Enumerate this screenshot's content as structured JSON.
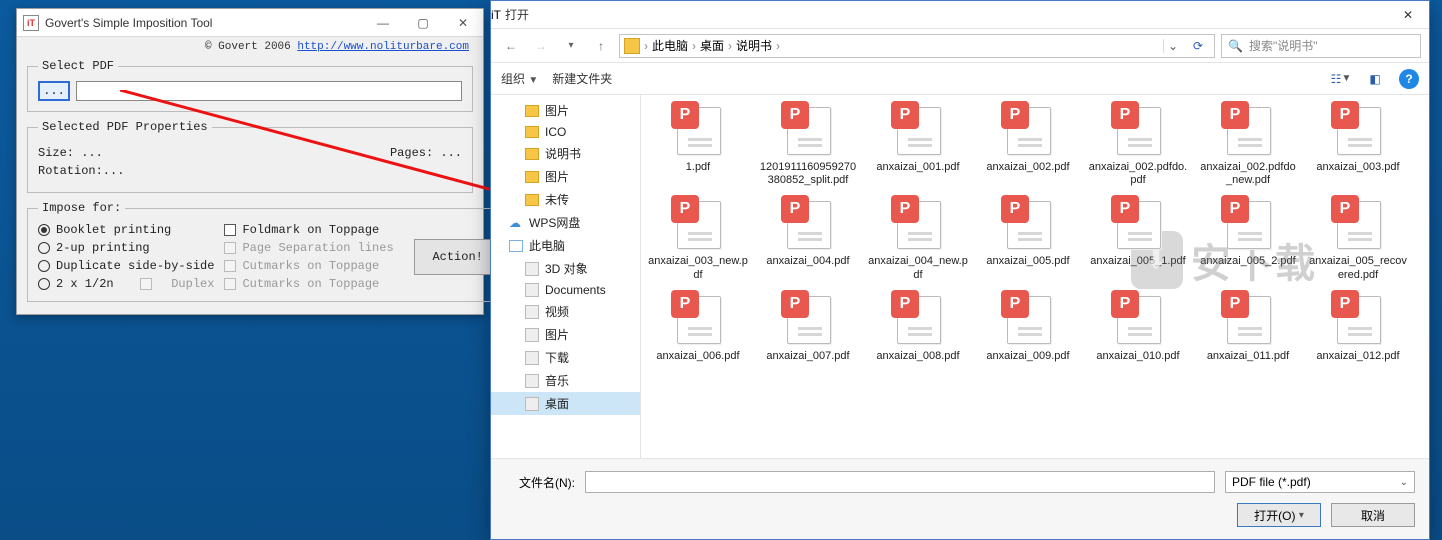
{
  "tool": {
    "title": "Govert's Simple Imposition Tool",
    "copyright_prefix": "© Govert 2006 ",
    "copyright_link": "http://www.noliturbare.com",
    "select_pdf_legend": "Select PDF",
    "browse_label": "...",
    "props_legend": "Selected PDF Properties",
    "size_label": "Size:   ...",
    "pages_label": "Pages:  ...",
    "rotation_label": "Rotation:...",
    "impose_legend": "Impose for:",
    "options": {
      "booklet": "Booklet printing",
      "twoup": "2-up printing",
      "duplicate": "Duplicate side-by-side",
      "twox": "2 x 1/2n",
      "duplex": "Duplex"
    },
    "checks": {
      "foldmark": "Foldmark on Toppage",
      "pagesep": "Page Separation lines",
      "cutmarks1": "Cutmarks on Toppage",
      "cutmarks2": "Cutmarks on Toppage"
    },
    "action": "Action!"
  },
  "open": {
    "title": "打开",
    "breadcrumb": [
      "此电脑",
      "桌面",
      "说明书"
    ],
    "search_placeholder": "搜索\"说明书\"",
    "toolbar": {
      "organize": "组织",
      "newfolder": "新建文件夹"
    },
    "tree": [
      {
        "label": "图片",
        "icon": "folder",
        "indent": true
      },
      {
        "label": "ICO",
        "icon": "folder",
        "indent": true
      },
      {
        "label": "说明书",
        "icon": "folder",
        "indent": true
      },
      {
        "label": "图片",
        "icon": "folder",
        "indent": true
      },
      {
        "label": "未传",
        "icon": "folder",
        "indent": true
      },
      {
        "label": "WPS网盘",
        "icon": "cloud",
        "indent": false
      },
      {
        "label": "此电脑",
        "icon": "pc",
        "indent": false
      },
      {
        "label": "3D 对象",
        "icon": "obj",
        "indent": true
      },
      {
        "label": "Documents",
        "icon": "doc",
        "indent": true
      },
      {
        "label": "视频",
        "icon": "video",
        "indent": true
      },
      {
        "label": "图片",
        "icon": "pic",
        "indent": true
      },
      {
        "label": "下载",
        "icon": "dl",
        "indent": true
      },
      {
        "label": "音乐",
        "icon": "music",
        "indent": true
      },
      {
        "label": "桌面",
        "icon": "desktop",
        "indent": true,
        "selected": true
      }
    ],
    "files": [
      "1.pdf",
      "1201911160959270380852_split.pdf",
      "anxaizai_001.pdf",
      "anxaizai_002.pdf",
      "anxaizai_002.pdfdo.pdf",
      "anxaizai_002.pdfdo_new.pdf",
      "anxaizai_003.pdf",
      "anxaizai_003_new.pdf",
      "anxaizai_004.pdf",
      "anxaizai_004_new.pdf",
      "anxaizai_005.pdf",
      "anxaizai_005_1.pdf",
      "anxaizai_005_2.pdf",
      "anxaizai_005_recovered.pdf",
      "anxaizai_006.pdf",
      "anxaizai_007.pdf",
      "anxaizai_008.pdf",
      "anxaizai_009.pdf",
      "anxaizai_010.pdf",
      "anxaizai_011.pdf",
      "anxaizai_012.pdf"
    ],
    "filename_label": "文件名(N):",
    "filter": "PDF file (*.pdf)",
    "open_btn": "打开(O)",
    "cancel_btn": "取消"
  },
  "watermark": "安下载"
}
